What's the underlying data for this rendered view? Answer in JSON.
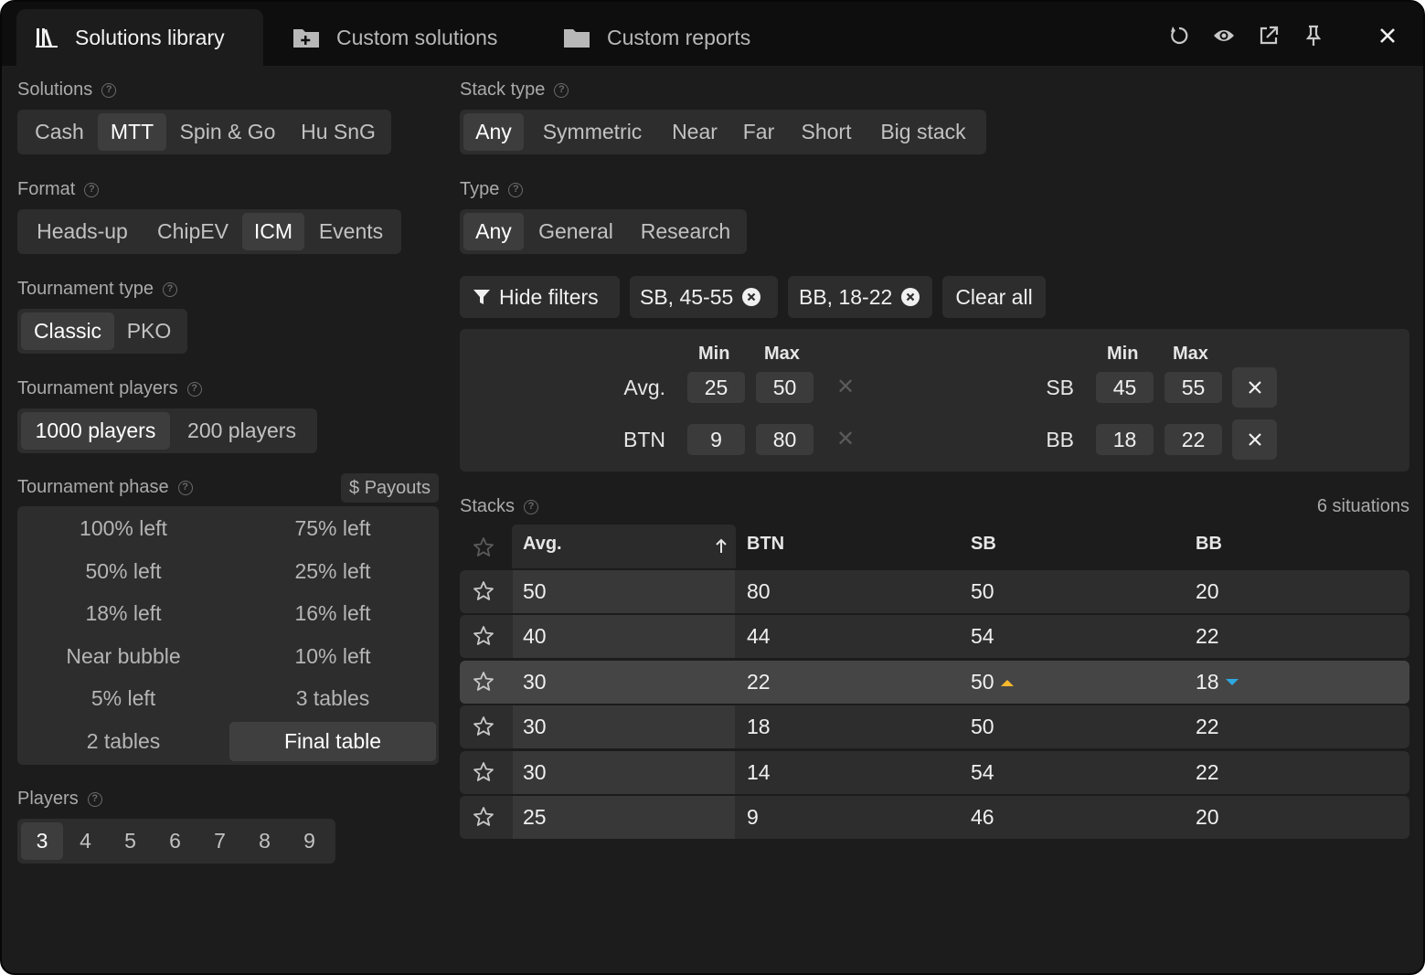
{
  "tabs": [
    {
      "label": "Solutions library",
      "icon": "library-icon"
    },
    {
      "label": "Custom solutions",
      "icon": "folder-plus-icon"
    },
    {
      "label": "Custom reports",
      "icon": "folder-icon"
    }
  ],
  "toolbar": {
    "icons": [
      "refresh-icon",
      "eye-icon",
      "external-link-icon",
      "pin-icon",
      "close-icon"
    ]
  },
  "solutions": {
    "label": "Solutions",
    "options": [
      "Cash",
      "MTT",
      "Spin & Go",
      "Hu SnG"
    ],
    "selected": "MTT"
  },
  "format": {
    "label": "Format",
    "options": [
      "Heads-up",
      "ChipEV",
      "ICM",
      "Events"
    ],
    "selected": "ICM"
  },
  "tournament_type": {
    "label": "Tournament type",
    "options": [
      "Classic",
      "PKO"
    ],
    "selected": "Classic"
  },
  "tournament_players": {
    "label": "Tournament players",
    "options": [
      "1000 players",
      "200 players"
    ],
    "selected": "1000 players"
  },
  "tournament_phase": {
    "label": "Tournament phase",
    "payouts_label": "$ Payouts",
    "options": [
      "100% left",
      "75% left",
      "50% left",
      "25% left",
      "18% left",
      "16% left",
      "Near bubble",
      "10% left",
      "5% left",
      "3 tables",
      "2 tables",
      "Final table"
    ],
    "selected": "Final table"
  },
  "players": {
    "label": "Players",
    "options": [
      "3",
      "4",
      "5",
      "6",
      "7",
      "8",
      "9"
    ],
    "selected": "3"
  },
  "stack_type": {
    "label": "Stack type",
    "options": [
      "Any",
      "Symmetric",
      "Near",
      "Far",
      "Short",
      "Big stack"
    ],
    "selected": "Any"
  },
  "type": {
    "label": "Type",
    "options": [
      "Any",
      "General",
      "Research"
    ],
    "selected": "Any"
  },
  "filter_bar": {
    "hide_filters": "Hide filters",
    "chips": [
      "SB, 45-55",
      "BB, 18-22"
    ],
    "clear_all": "Clear all"
  },
  "filters": {
    "min_label": "Min",
    "max_label": "Max",
    "left": [
      {
        "label": "Avg.",
        "min": "25",
        "max": "50"
      },
      {
        "label": "BTN",
        "min": "9",
        "max": "80"
      }
    ],
    "right": [
      {
        "label": "SB",
        "min": "45",
        "max": "55"
      },
      {
        "label": "BB",
        "min": "18",
        "max": "22"
      }
    ]
  },
  "stacks": {
    "label": "Stacks",
    "count": "6 situations",
    "columns": [
      "Avg.",
      "BTN",
      "SB",
      "BB"
    ],
    "sort_column": "Avg.",
    "rows": [
      {
        "avg": "50",
        "btn": "80",
        "sb": "50",
        "bb": "20"
      },
      {
        "avg": "40",
        "btn": "44",
        "sb": "54",
        "bb": "22"
      },
      {
        "avg": "30",
        "btn": "22",
        "sb": "50",
        "bb": "18",
        "selected": true,
        "sb_trend": "up",
        "bb_trend": "down"
      },
      {
        "avg": "30",
        "btn": "18",
        "sb": "50",
        "bb": "22"
      },
      {
        "avg": "30",
        "btn": "14",
        "sb": "54",
        "bb": "22"
      },
      {
        "avg": "25",
        "btn": "9",
        "sb": "46",
        "bb": "20"
      }
    ]
  },
  "colors": {
    "background": "#1c1c1c",
    "tab_bar": "#0e0e0e",
    "segment": "#2d2d2d",
    "segment_selected": "#3d3d3d",
    "trend_up": "#f5b82e",
    "trend_down": "#2ea8e0"
  }
}
